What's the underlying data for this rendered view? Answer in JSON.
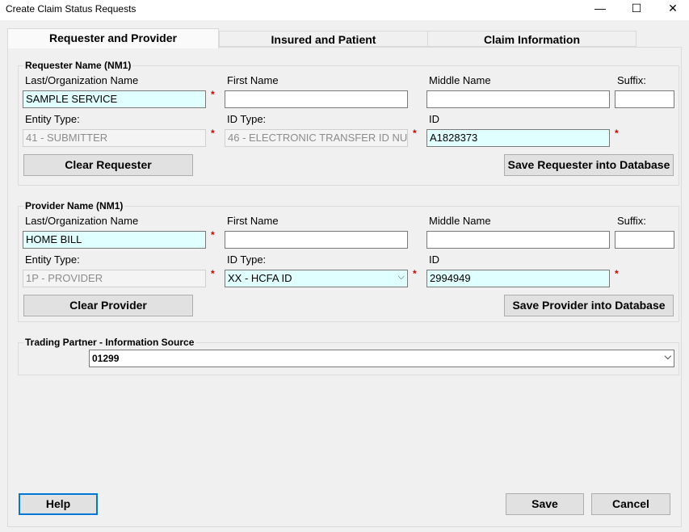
{
  "window": {
    "title": "Create Claim Status Requests",
    "minimize_glyph": "—",
    "maximize_glyph": "☐",
    "close_glyph": "✕"
  },
  "tabs": [
    {
      "label": "Requester and Provider",
      "active": true
    },
    {
      "label": "Insured and Patient",
      "active": false
    },
    {
      "label": "Claim Information",
      "active": false
    }
  ],
  "requester": {
    "group_title": "Requester Name (NM1)",
    "last_name_label": "Last/Organization Name",
    "last_name_value": "SAMPLE SERVICE",
    "first_name_label": "First Name",
    "first_name_value": "",
    "middle_name_label": "Middle Name",
    "middle_name_value": "",
    "suffix_label": "Suffix:",
    "suffix_value": "",
    "entity_type_label": "Entity Type:",
    "entity_type_value": "41 - SUBMITTER",
    "id_type_label": "ID Type:",
    "id_type_value": "46 - ELECTRONIC TRANSFER ID NU",
    "id_label": "ID",
    "id_value": "A1828373",
    "clear_button": "Clear Requester",
    "save_button": "Save Requester into Database"
  },
  "provider": {
    "group_title": "Provider Name (NM1)",
    "last_name_label": "Last/Organization Name",
    "last_name_value": "HOME BILL",
    "first_name_label": "First Name",
    "first_name_value": "",
    "middle_name_label": "Middle Name",
    "middle_name_value": "",
    "suffix_label": "Suffix:",
    "suffix_value": "",
    "entity_type_label": "Entity Type:",
    "entity_type_value": "1P - PROVIDER",
    "id_type_label": "ID Type:",
    "id_type_value": "XX - HCFA ID",
    "id_label": "ID",
    "id_value": "2994949",
    "clear_button": "Clear Provider",
    "save_button": "Save Provider into Database"
  },
  "trading_partner": {
    "group_title": "Trading Partner - Information Source",
    "value": "01299"
  },
  "required_marker": "*",
  "dropdown_glyph": "⌵",
  "footer": {
    "help_button": "Help",
    "save_button": "Save",
    "cancel_button": "Cancel"
  },
  "colors": {
    "required_field_bg": "#e0ffff",
    "required_marker": "#d40000",
    "focus_border": "#0078d7"
  }
}
